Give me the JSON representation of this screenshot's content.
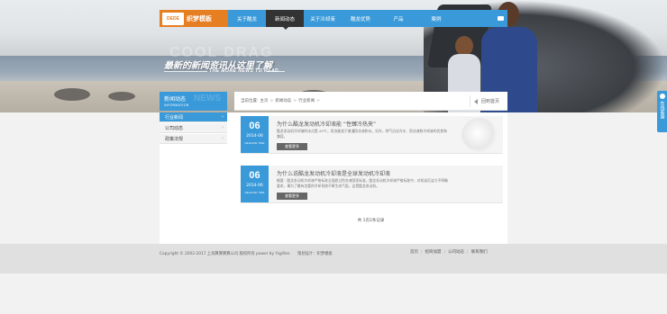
{
  "header": {
    "logo_mark": "DEDE",
    "logo_text": "织梦模板",
    "nav": [
      {
        "label": "关于酷龙",
        "active": false
      },
      {
        "label": "新闻动态",
        "active": true
      },
      {
        "label": "关于冷却液",
        "active": false
      },
      {
        "label": "酷龙优势",
        "active": false
      },
      {
        "label": "产品",
        "active": false
      },
      {
        "label": "案例",
        "active": false
      }
    ]
  },
  "banner": {
    "watermark": "COOL DRAG",
    "slogan": "最新的新闻资讯从这里了解",
    "slogan_en": "THE MORE NEWS TO READ"
  },
  "sidebar": {
    "title": "新闻动态",
    "title_en": "INFORMATION",
    "ghost": "NEWS",
    "items": [
      {
        "label": "行业新闻",
        "active": true
      },
      {
        "label": "公司动态",
        "active": false
      },
      {
        "label": "政策法规",
        "active": false
      }
    ]
  },
  "breadcrumb": {
    "prefix": "当前位置:",
    "items": [
      "主页",
      "新闻动态",
      "行业新闻"
    ],
    "back_label": "回到首页"
  },
  "articles": [
    {
      "day": "06",
      "ym": "2014-06",
      "rel": "RELEASE TIME",
      "title": "为什么酷龙发动机冷却液能 “性臻冷热夹”",
      "summary": "酷龙发动机冷却液的冰点是-45℃，防冻能抵于普通防冻液和水。另外，除气沿化冷水、防冻液和冷却液的优势和兼容。",
      "more": "查看更多"
    },
    {
      "day": "06",
      "ym": "2014-06",
      "rel": "RELEASE TIME",
      "title": "为什么说酷龙发动机冷却液是全球发动机冷却液",
      "summary": "概要：酷龙发动机冷却液严格标准全面超过防冻液国家标准。酷龙发动机冷却液严格标准中，对机油沉淀力不明确要求，事为了最有怎重的冷却系统不断生成气阻，这是酷龙发动机。",
      "more": "查看更多"
    }
  ],
  "pager": "共 1页2条记录",
  "footer": {
    "copyright": "Copyright © 2002-2017 上海算算算算公司 版权所有 power by YqyRen　　策划设计：织梦模板",
    "links": [
      "首页",
      "招商加盟",
      "公司动态",
      "联系我们"
    ]
  },
  "service": {
    "label": "在线客服"
  },
  "colors": {
    "accent": "#3a9ad9",
    "logo": "#e67e22",
    "nav_active": "#333333"
  }
}
